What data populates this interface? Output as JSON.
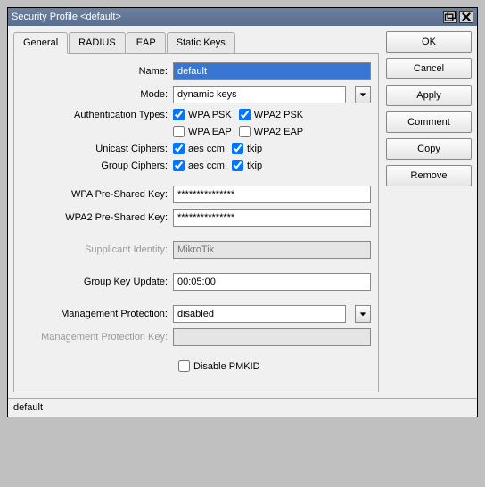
{
  "title": "Security Profile <default>",
  "buttons": {
    "ok": "OK",
    "cancel": "Cancel",
    "apply": "Apply",
    "comment": "Comment",
    "copy": "Copy",
    "remove": "Remove"
  },
  "tabs": {
    "general": "General",
    "radius": "RADIUS",
    "eap": "EAP",
    "static_keys": "Static Keys"
  },
  "labels": {
    "name": "Name:",
    "mode": "Mode:",
    "auth_types": "Authentication Types:",
    "unicast": "Unicast Ciphers:",
    "group": "Group Ciphers:",
    "wpa_psk": "WPA Pre-Shared Key:",
    "wpa2_psk": "WPA2 Pre-Shared Key:",
    "supplicant": "Supplicant Identity:",
    "group_key_update": "Group Key Update:",
    "mgmt_protection": "Management Protection:",
    "mgmt_protection_key": "Management Protection Key:",
    "disable_pmkid": "Disable PMKID"
  },
  "values": {
    "name": "default",
    "mode": "dynamic keys",
    "wpa_psk_checked": true,
    "wpa2_psk_checked": true,
    "wpa_eap_checked": false,
    "wpa2_eap_checked": false,
    "wpa_psk_label": "WPA PSK",
    "wpa2_psk_label": "WPA2 PSK",
    "wpa_eap_label": "WPA EAP",
    "wpa2_eap_label": "WPA2 EAP",
    "aes_ccm_label": "aes ccm",
    "tkip_label": "tkip",
    "unicast_aes": true,
    "unicast_tkip": true,
    "group_aes": true,
    "group_tkip": true,
    "wpa_psk_value": "***************",
    "wpa2_psk_value": "***************",
    "supplicant": "MikroTik",
    "group_key_update": "00:05:00",
    "mgmt_protection": "disabled",
    "mgmt_protection_key": "",
    "disable_pmkid": false
  },
  "status": "default"
}
